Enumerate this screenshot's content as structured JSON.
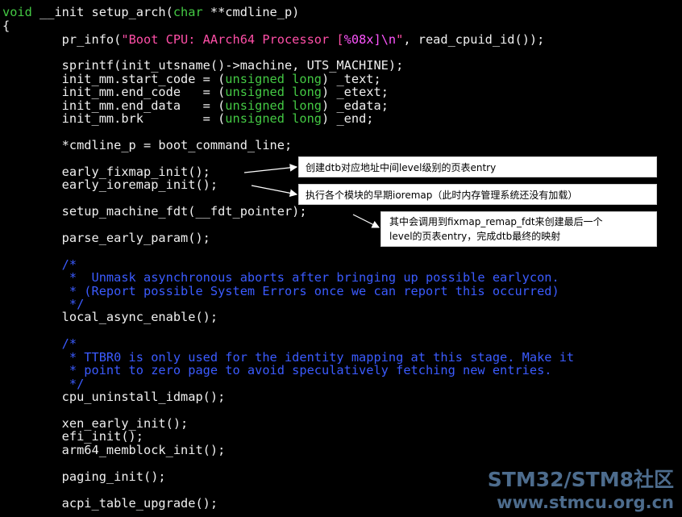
{
  "code": {
    "l1": {
      "kw": "void",
      "rest": " __init setup_arch(",
      "kw2": "char",
      "rest2": " **cmdline_p)"
    },
    "l2": "{",
    "l3": {
      "pre": "        pr_info(",
      "str1": "\"Boot CPU: AArch64 Processor [",
      "fmt": "%08x]\\n",
      "str2": "\"",
      "post": ", read_cpuid_id());"
    },
    "l4": "        sprintf(init_utsname()->machine, UTS_MACHINE);",
    "l5": {
      "pre": "        init_mm.start_code = (",
      "kw": "unsigned long",
      "post": ") _text;"
    },
    "l6": {
      "pre": "        init_mm.end_code   = (",
      "kw": "unsigned long",
      "post": ") _etext;"
    },
    "l7": {
      "pre": "        init_mm.end_data   = (",
      "kw": "unsigned long",
      "post": ") _edata;"
    },
    "l8": {
      "pre": "        init_mm.brk        = (",
      "kw": "unsigned long",
      "post": ") _end;"
    },
    "l9": "        *cmdline_p = boot_command_line;",
    "l10": "        early_fixmap_init();",
    "l11": "        early_ioremap_init();",
    "l12": "        setup_machine_fdt(__fdt_pointer);",
    "l13": "        parse_early_param();",
    "l14": "        /*",
    "l15": "         *  Unmask asynchronous aborts after bringing up possible earlycon.",
    "l16": "         * (Report possible System Errors once we can report this occurred)",
    "l17": "         */",
    "l18": "        local_async_enable();",
    "l19": "        /*",
    "l20": "         * TTBR0 is only used for the identity mapping at this stage. Make it",
    "l21": "         * point to zero page to avoid speculatively fetching new entries.",
    "l22": "         */",
    "l23": "        cpu_uninstall_idmap();",
    "l24": "        xen_early_init();",
    "l25": "        efi_init();",
    "l26": "        arm64_memblock_init();",
    "l27": "        paging_init();",
    "l28": "        acpi_table_upgrade();"
  },
  "annotations": {
    "a1": "创建dtb对应地址中间level级别的页表entry",
    "a2": "执行各个模块的早期ioremap（此时内存管理系统还没有加载）",
    "a3_line1": "其中会调用到fixmap_remap_fdt来创建最后一个",
    "a3_line2": "level的页表entry，完成dtb最终的映射"
  },
  "watermark": {
    "line1": "STM32/STM8社区",
    "line2": "www.stmcu.org.cn"
  }
}
